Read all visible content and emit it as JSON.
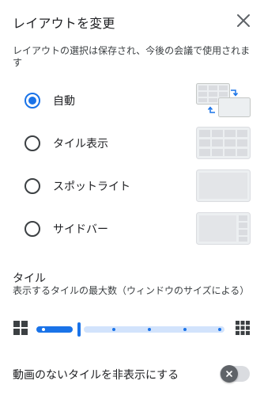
{
  "dialog": {
    "title": "レイアウトを変更",
    "description": "レイアウトの選択は保存され、今後の会議で使用されます"
  },
  "layout_options": [
    {
      "label": "自動",
      "selected": true,
      "icon": "auto-layout-thumbnail"
    },
    {
      "label": "タイル表示",
      "selected": false,
      "icon": "tiled-layout-thumbnail"
    },
    {
      "label": "スポットライト",
      "selected": false,
      "icon": "spotlight-layout-thumbnail"
    },
    {
      "label": "サイドバー",
      "selected": false,
      "icon": "sidebar-layout-thumbnail"
    }
  ],
  "tiles": {
    "heading": "タイル",
    "description": "表示するタイルの最大数（ウィンドウのサイズによる）",
    "slider_level_percent": 22,
    "min_icon": "small-grid-icon",
    "max_icon": "large-grid-icon"
  },
  "hide_no_video": {
    "label": "動画のないタイルを非表示にする",
    "enabled": false
  },
  "colors": {
    "accent": "#1a73e8",
    "track_light": "#d2e3fc",
    "text": "#202124"
  }
}
